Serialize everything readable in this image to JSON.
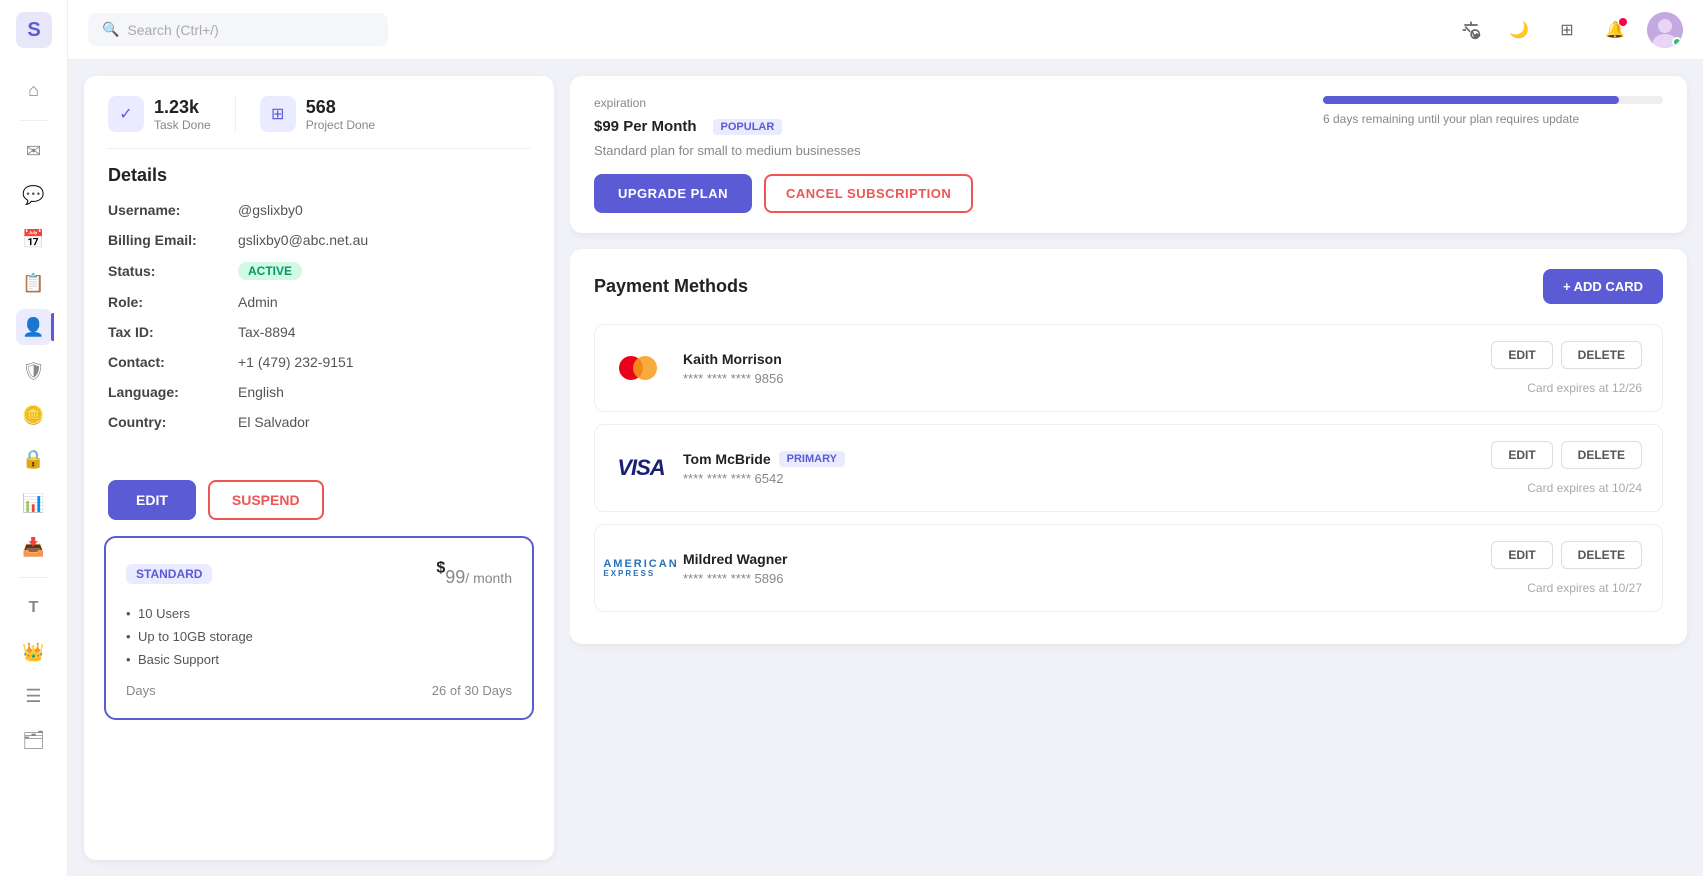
{
  "app": {
    "logo": "S",
    "search_placeholder": "Search (Ctrl+/)"
  },
  "sidebar": {
    "items": [
      {
        "name": "home",
        "icon": "⌂",
        "active": false
      },
      {
        "name": "mail",
        "icon": "✉",
        "active": false
      },
      {
        "name": "chat",
        "icon": "💬",
        "active": false
      },
      {
        "name": "calendar",
        "icon": "📅",
        "active": false
      },
      {
        "name": "notes",
        "icon": "📋",
        "active": false
      },
      {
        "name": "users",
        "icon": "👤",
        "active": true
      },
      {
        "name": "security",
        "icon": "🛡",
        "active": false
      },
      {
        "name": "billing",
        "icon": "🪙",
        "active": false
      },
      {
        "name": "lock",
        "icon": "🔒",
        "active": false
      },
      {
        "name": "reports",
        "icon": "📊",
        "active": false
      },
      {
        "name": "download",
        "icon": "📥",
        "active": false
      },
      {
        "name": "text",
        "icon": "T",
        "active": false
      },
      {
        "name": "crown",
        "icon": "👑",
        "active": false
      },
      {
        "name": "layers",
        "icon": "☰",
        "active": false
      },
      {
        "name": "archive",
        "icon": "🗂",
        "active": false
      }
    ]
  },
  "stats": {
    "task_done_value": "1.23k",
    "task_done_label": "Task Done",
    "project_done_value": "568",
    "project_done_label": "Project Done"
  },
  "details": {
    "title": "Details",
    "username_label": "Username:",
    "username_value": "@gslixby0",
    "billing_email_label": "Billing Email:",
    "billing_email_value": "gslixby0@abc.net.au",
    "status_label": "Status:",
    "status_value": "ACTIVE",
    "role_label": "Role:",
    "role_value": "Admin",
    "tax_id_label": "Tax ID:",
    "tax_id_value": "Tax-8894",
    "contact_label": "Contact:",
    "contact_value": "+1 (479) 232-9151",
    "language_label": "Language:",
    "language_value": "English",
    "country_label": "Country:",
    "country_value": "El Salvador"
  },
  "actions": {
    "edit_label": "EDIT",
    "suspend_label": "SUSPEND"
  },
  "plan_card": {
    "badge": "STANDARD",
    "price_symbol": "$",
    "price": "99",
    "price_period": "/ month",
    "features": [
      "10 Users",
      "Up to 10GB storage",
      "Basic Support"
    ],
    "days_label": "Days",
    "days_value": "26 of 30 Days"
  },
  "plan_info": {
    "price": "$99 Per Month",
    "popular_label": "POPULAR",
    "description": "Standard plan for small to medium businesses",
    "upgrade_label": "UPGRADE PLAN",
    "cancel_label": "CANCEL SUBSCRIPTION",
    "expiry_label": "expiration",
    "progress_percent": 87,
    "days_remaining": "6 days remaining until your plan requires update"
  },
  "payment": {
    "title": "Payment Methods",
    "add_card_label": "+ ADD CARD",
    "cards": [
      {
        "type": "mastercard",
        "name": "Kaith Morrison",
        "number": "**** **** **** 9856",
        "expires": "Card expires at 12/26",
        "primary": false
      },
      {
        "type": "visa",
        "name": "Tom McBride",
        "number": "**** **** **** 6542",
        "expires": "Card expires at 10/24",
        "primary": true,
        "primary_label": "PRIMARY"
      },
      {
        "type": "amex",
        "name": "Mildred Wagner",
        "number": "**** **** **** 5896",
        "expires": "Card expires at 10/27",
        "primary": false
      }
    ],
    "edit_label": "EDIT",
    "delete_label": "DELETE"
  }
}
